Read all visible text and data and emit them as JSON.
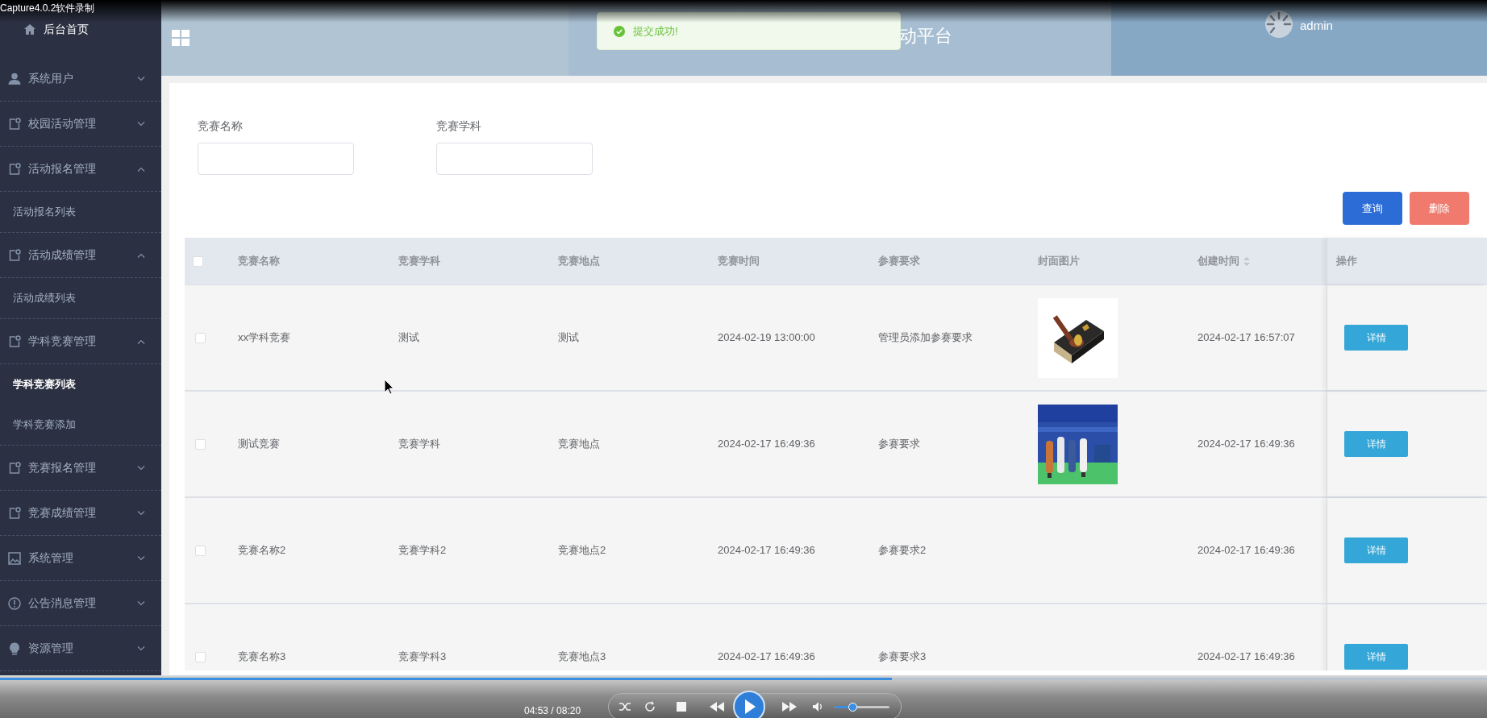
{
  "recorder": {
    "title": "Capture4.0.2软件录制"
  },
  "sidebar": {
    "home": "后台首页",
    "items": [
      {
        "label": "系统用户",
        "expanded": false
      },
      {
        "label": "校园活动管理",
        "expanded": false
      },
      {
        "label": "活动报名管理",
        "expanded": true,
        "children": [
          {
            "label": "活动报名列表",
            "selected": false
          }
        ]
      },
      {
        "label": "活动成绩管理",
        "expanded": true,
        "children": [
          {
            "label": "活动成绩列表",
            "selected": false
          }
        ]
      },
      {
        "label": "学科竞赛管理",
        "expanded": true,
        "children": [
          {
            "label": "学科竞赛列表",
            "selected": true
          },
          {
            "label": "学科竞赛添加",
            "selected": false
          }
        ]
      },
      {
        "label": "竞赛报名管理",
        "expanded": false
      },
      {
        "label": "竞赛成绩管理",
        "expanded": false
      },
      {
        "label": "系统管理",
        "expanded": false
      },
      {
        "label": "公告消息管理",
        "expanded": false
      },
      {
        "label": "资源管理",
        "expanded": false
      }
    ]
  },
  "header": {
    "title": "动平台",
    "user": "admin"
  },
  "toast": {
    "message": "提交成功!"
  },
  "search": {
    "fields": [
      {
        "label": "竞赛名称"
      },
      {
        "label": "竞赛学科"
      }
    ],
    "buttons": [
      "查询",
      "删除"
    ]
  },
  "table": {
    "header_checked": false,
    "columns": [
      {
        "label": "竞赛名称",
        "sortable": false
      },
      {
        "label": "竞赛学科",
        "sortable": false
      },
      {
        "label": "竞赛地点",
        "sortable": false
      },
      {
        "label": "竞赛时间",
        "sortable": false
      },
      {
        "label": "参赛要求",
        "sortable": false
      },
      {
        "label": "封面图片",
        "sortable": false
      },
      {
        "label": "创建时间",
        "sortable": true
      },
      {
        "label": "操作",
        "sortable": false
      }
    ],
    "rows": [
      {
        "checked": false,
        "cells": [
          "xx学科竞赛",
          "测试",
          "测试",
          "2024-02-19 13:00:00",
          "管理员添加参赛要求"
        ],
        "created": "2024-02-17 16:57:07",
        "action": "详情"
      },
      {
        "checked": false,
        "cells": [
          "测试竞赛",
          "竞赛学科",
          "竞赛地点",
          "2024-02-17 16:49:36",
          "参赛要求"
        ],
        "created": "2024-02-17 16:49:36",
        "action": "详情"
      },
      {
        "checked": false,
        "cells": [
          "竞赛名称2",
          "竞赛学科2",
          "竞赛地点2",
          "2024-02-17 16:49:36",
          "参赛要求2"
        ],
        "created": "2024-02-17 16:49:36",
        "action": "详情"
      },
      {
        "checked": false,
        "cells": [
          "竞赛名称3",
          "竞赛学科3",
          "竞赛地点3",
          "2024-02-17 16:49:36",
          "参赛要求3"
        ],
        "created": "2024-02-17 16:49:36",
        "action": "详情"
      }
    ]
  },
  "player": {
    "time": "04:53 / 08:20",
    "progress": {
      "level": 0.6
    },
    "volume": {
      "level": 0.33
    }
  }
}
